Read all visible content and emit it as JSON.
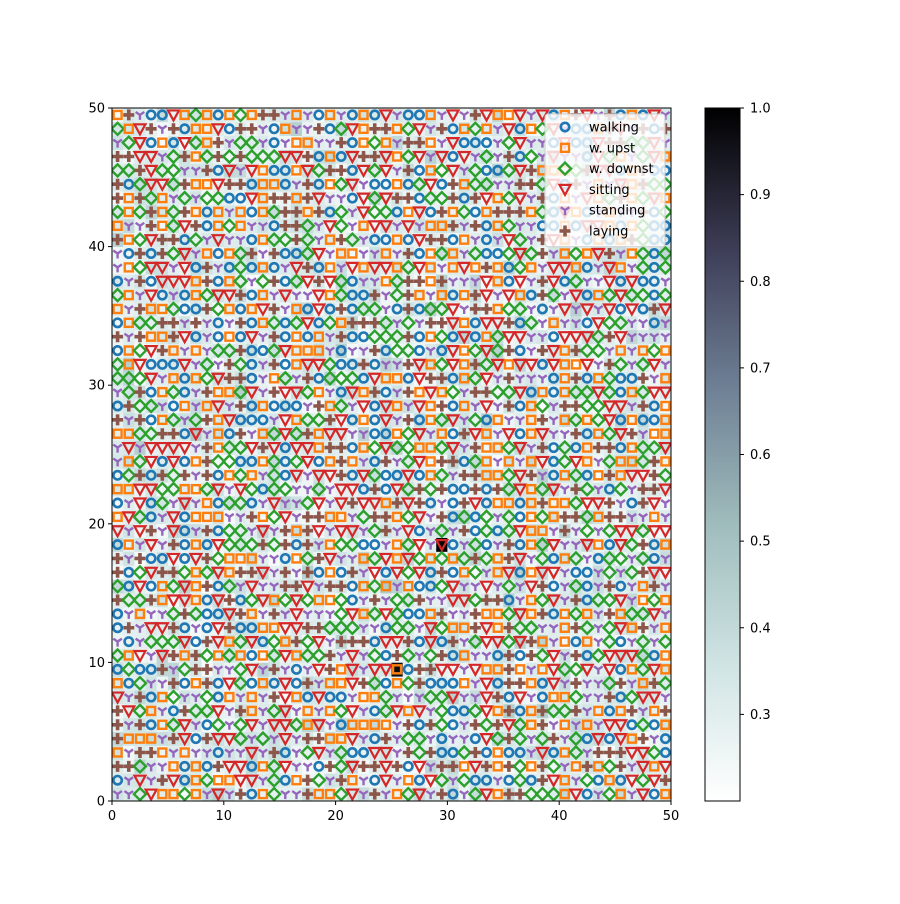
{
  "chart_data": {
    "type": "heatmap",
    "title": "",
    "xlabel": "",
    "ylabel": "",
    "grid": {
      "rows": 50,
      "cols": 50
    },
    "xlim": [
      0,
      50
    ],
    "ylim": [
      0,
      50
    ],
    "x_ticks": [
      "0",
      "10",
      "20",
      "30",
      "40",
      "50"
    ],
    "y_ticks": [
      "0",
      "10",
      "20",
      "30",
      "40",
      "50"
    ],
    "colormap": "bone_r",
    "colorbar": {
      "range": [
        0.2,
        1.0
      ],
      "ticks": [
        "0.3",
        "0.4",
        "0.5",
        "0.6",
        "0.7",
        "0.8",
        "0.9",
        "1.0"
      ]
    },
    "heatmap_description_values": {
      "typical_range": [
        0.22,
        0.48
      ],
      "dark_cells": [
        {
          "x": 29.5,
          "y": 18.5,
          "value": 1.0
        },
        {
          "x": 25.5,
          "y": 9.5,
          "value": 0.97
        }
      ]
    },
    "legend": {
      "placement": "top-right",
      "series": [
        {
          "name": "walking",
          "marker": "circle",
          "color": "#1f77b4"
        },
        {
          "name": "w. upst",
          "marker": "square",
          "color": "#ff7f0e"
        },
        {
          "name": "w. downst",
          "marker": "diamond",
          "color": "#2ca02c"
        },
        {
          "name": "sitting",
          "marker": "triangle_down",
          "color": "#d62728"
        },
        {
          "name": "standing",
          "marker": "tri_down",
          "color": "#9467bd"
        },
        {
          "name": "laying",
          "marker": "plus_filled",
          "color": "#8c564b"
        }
      ]
    },
    "markers_at_cell_centers": true
  }
}
